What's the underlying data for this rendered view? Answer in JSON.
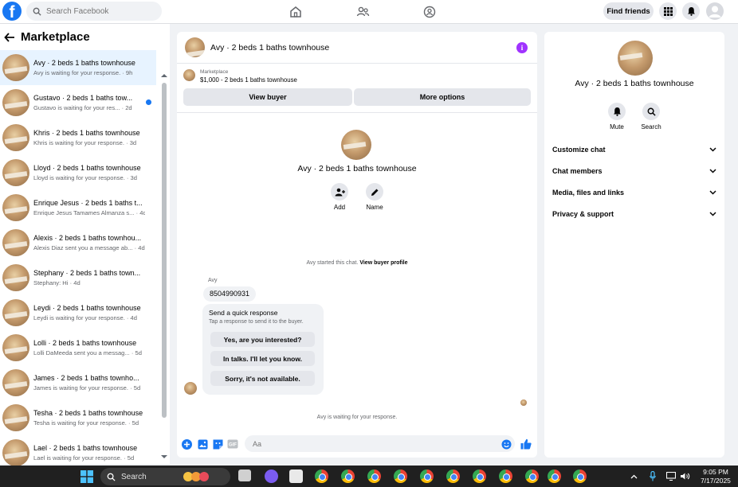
{
  "topbar": {
    "logo": "f",
    "search_placeholder": "Search Facebook",
    "find_friends": "Find friends"
  },
  "sidebar": {
    "title": "Marketplace",
    "conversations": [
      {
        "title": "Avy · 2 beds 1 baths townhouse",
        "subtitle": "Avy is waiting for your response. · 9h",
        "active": true,
        "unread": false
      },
      {
        "title": "Gustavo · 2 beds 1 baths tow...",
        "subtitle": "Gustavo is waiting for your res... · 2d",
        "active": false,
        "unread": true
      },
      {
        "title": "Khris · 2 beds 1 baths townhouse",
        "subtitle": "Khris is waiting for your response. · 3d",
        "active": false,
        "unread": false
      },
      {
        "title": "Lloyd · 2 beds 1 baths townhouse",
        "subtitle": "Lloyd is waiting for your response. · 3d",
        "active": false,
        "unread": false
      },
      {
        "title": "Enrique Jesus · 2 beds 1 baths t...",
        "subtitle": "Enrique Jesus Tamames Almanza s... · 4d",
        "active": false,
        "unread": false
      },
      {
        "title": "Alexis · 2 beds 1 baths townhou...",
        "subtitle": "Alexis Diaz sent you a message ab... · 4d",
        "active": false,
        "unread": false
      },
      {
        "title": "Stephany · 2 beds 1 baths town...",
        "subtitle": "Stephany: Hi · 4d",
        "active": false,
        "unread": false
      },
      {
        "title": "Leydi · 2 beds 1 baths townhouse",
        "subtitle": "Leydi is waiting for your response. · 4d",
        "active": false,
        "unread": false
      },
      {
        "title": "Lolli · 2 beds 1 baths townhouse",
        "subtitle": "Lolli DaMeeda sent you a messag... · 5d",
        "active": false,
        "unread": false
      },
      {
        "title": "James · 2 beds 1 baths townho...",
        "subtitle": "James is waiting for your response. · 5d",
        "active": false,
        "unread": false
      },
      {
        "title": "Tesha · 2 beds 1 baths townhouse",
        "subtitle": "Tesha is waiting for your response. · 5d",
        "active": false,
        "unread": false
      },
      {
        "title": "Lael · 2 beds 1 baths townhouse",
        "subtitle": "Lael is waiting for your response. · 5d",
        "active": false,
        "unread": false
      }
    ]
  },
  "chat": {
    "header_title": "Avy · 2 beds 1 baths townhouse",
    "marketplace_label": "Marketplace",
    "listing": "$1,000 - 2 beds 1 baths townhouse",
    "view_buyer": "View buyer",
    "more_options": "More options",
    "intro_title": "Avy · 2 beds 1 baths townhouse",
    "add_label": "Add",
    "name_label": "Name",
    "started_text": "Avy started this chat.",
    "view_profile": "View buyer profile",
    "sender": "Avy",
    "phone_message": "8504990931",
    "quick_title": "Send a quick response",
    "quick_sub": "Tap a response to send it to the buyer.",
    "quick_replies": [
      "Yes, are you interested?",
      "In talks. I'll let you know.",
      "Sorry, it's not available."
    ],
    "waiting": "Avy is waiting for your response.",
    "input_placeholder": "Aa"
  },
  "details": {
    "title": "Avy · 2 beds 1 baths townhouse",
    "mute": "Mute",
    "search": "Search",
    "sections": [
      "Customize chat",
      "Chat members",
      "Media, files and links",
      "Privacy & support"
    ]
  },
  "taskbar": {
    "search": "Search",
    "time": "9:05 PM",
    "date": "7/17/2025"
  },
  "colors": {
    "brand": "#1877f2",
    "info": "#a033ff",
    "active_row": "#e7f3ff"
  },
  "icons": [
    "facebook-logo",
    "search-icon",
    "home-icon",
    "friends-icon",
    "groups-icon",
    "grid-menu-icon",
    "bell-icon",
    "profile-icon",
    "back-arrow-icon",
    "info-icon",
    "add-person-icon",
    "pencil-icon",
    "plus-icon",
    "image-icon",
    "sticker-icon",
    "gif-icon",
    "emoji-icon",
    "like-icon",
    "chevron-down-icon",
    "windows-icon",
    "chrome-icon"
  ]
}
